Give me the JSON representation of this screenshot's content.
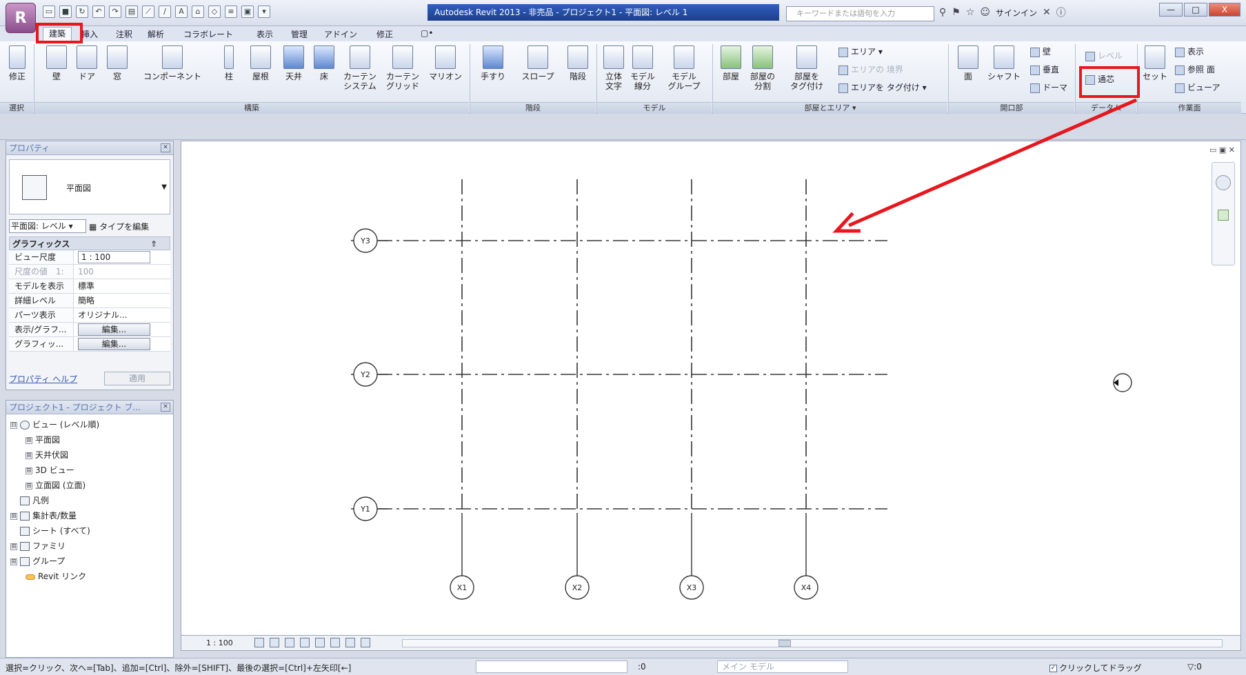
{
  "titlebar": {
    "app_icon_letter": "R",
    "title": "Autodesk Revit 2013 - 非売品 - プロジェクト1 - 平面図: レベル 1",
    "search_placeholder": "キーワードまたは語句を入力",
    "signin": "サインイン",
    "window_buttons": [
      "—",
      "□",
      "X"
    ]
  },
  "tabs": [
    {
      "label": "建築",
      "active": true
    },
    {
      "label": "挿入"
    },
    {
      "label": "注釈"
    },
    {
      "label": "解析"
    },
    {
      "label": "コラボレート"
    },
    {
      "label": "表示"
    },
    {
      "label": "管理"
    },
    {
      "label": "アドイン"
    },
    {
      "label": "修正"
    },
    {
      "label": "▢•"
    }
  ],
  "ribbon": {
    "select": {
      "modify": "修正",
      "panel": "選択"
    },
    "build": {
      "panel": "構築",
      "buttons": [
        "壁",
        "ドア",
        "窓",
        "コンポーネント",
        "柱",
        "屋根",
        "天井",
        "床",
        "カーテン\nシステム",
        "カーテン\nグリッド",
        "マリオン"
      ]
    },
    "circulation": {
      "panel": "階段",
      "buttons": [
        "手すり",
        "スロープ",
        "階段"
      ]
    },
    "model": {
      "panel": "モデル",
      "buttons": [
        "立体\n文字",
        "モデル\n線分",
        "モデル\nグループ"
      ]
    },
    "room": {
      "panel": "部屋とエリア ▾",
      "buttons": [
        "部屋",
        "部屋の\n分割",
        "部屋を\nタグ付け"
      ],
      "small": [
        "エリア ▾",
        "エリアの 境界",
        "エリアを タグ付け ▾"
      ]
    },
    "opening": {
      "panel": "開口部",
      "buttons": [
        "面",
        "シャフト"
      ],
      "small": [
        "壁",
        "垂直",
        "ドーマ"
      ]
    },
    "datum": {
      "panel": "データム",
      "small": [
        "レベル",
        "通芯"
      ]
    },
    "workplane": {
      "panel": "作業面",
      "buttons": [
        "セット"
      ],
      "small": [
        "表示",
        "参照 面",
        "ビューア"
      ]
    }
  },
  "properties": {
    "title": "プロパティ",
    "type_name": "平面図",
    "instance_dropdown": "平面図: レベル",
    "edit_type": "タイプを編集",
    "group": "グラフィックス",
    "rows": [
      {
        "key": "ビュー尺度",
        "value": "1 : 100"
      },
      {
        "key": "尺度の値　1:",
        "value": "100"
      },
      {
        "key": "モデルを表示",
        "value": "標準"
      },
      {
        "key": "詳細レベル",
        "value": "簡略"
      },
      {
        "key": "パーツ表示",
        "value": "オリジナル..."
      },
      {
        "key": "表示/グラフ...",
        "value": "編集..."
      },
      {
        "key": "グラフィッ...",
        "value": "編集..."
      }
    ],
    "help_link": "プロパティ ヘルプ",
    "apply": "適用"
  },
  "browser": {
    "title": "プロジェクト1 - プロジェクト ブ...",
    "nodes": [
      {
        "label": "ビュー (レベル順)",
        "toggle": "⊟"
      },
      {
        "label": "平面図",
        "toggle": "⊞"
      },
      {
        "label": "天井伏図",
        "toggle": "⊞"
      },
      {
        "label": "3D ビュー",
        "toggle": "⊞"
      },
      {
        "label": "立面図 (立面)",
        "toggle": "⊞"
      },
      {
        "label": "凡例",
        "toggle": ""
      },
      {
        "label": "集計表/数量",
        "toggle": "⊞"
      },
      {
        "label": "シート (すべて)",
        "toggle": ""
      },
      {
        "label": "ファミリ",
        "toggle": "⊞"
      },
      {
        "label": "グループ",
        "toggle": "⊞"
      },
      {
        "label": "Revit リンク",
        "toggle": ""
      }
    ]
  },
  "grids": {
    "vertical": [
      "X1",
      "X2",
      "X3",
      "X4"
    ],
    "horizontal": [
      "Y3",
      "Y2",
      "Y1"
    ]
  },
  "viewbar": {
    "scale": "1 : 100"
  },
  "status": {
    "message": "選択=クリック、次へ=[Tab]、追加=[Ctrl]、除外=[SHIFT]、最後の選択=[Ctrl]+左矢印[←]",
    "zero": ":0",
    "model": "メイン モデル",
    "drag": "クリックしてドラッグ",
    "filter": ":0"
  },
  "annotation_color": "#e8161d"
}
